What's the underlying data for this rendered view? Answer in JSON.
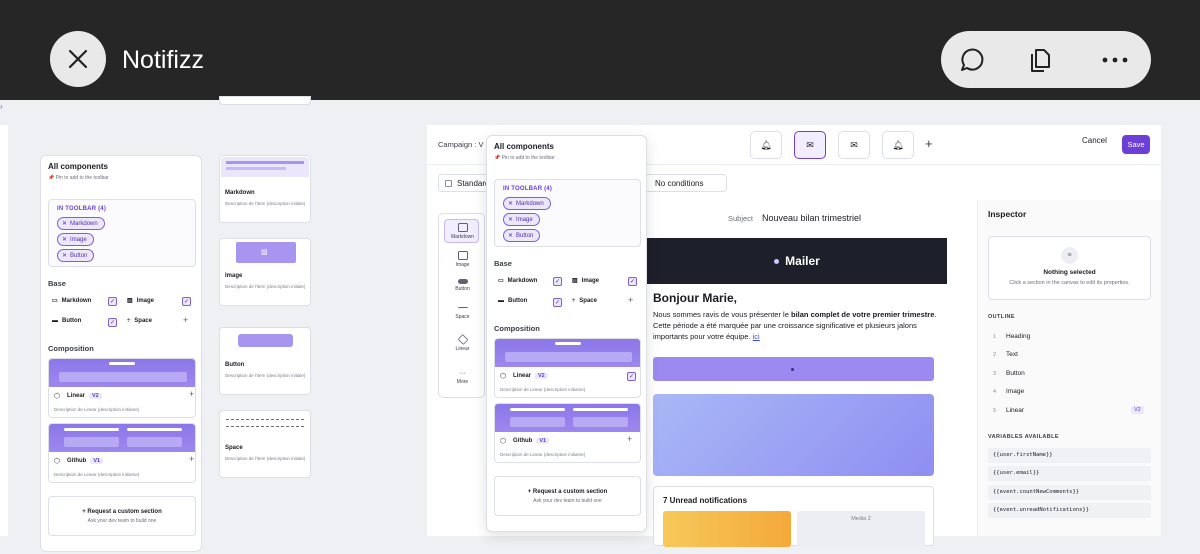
{
  "window": {
    "title": "Notifizz"
  },
  "left_panel": {
    "title": "All components",
    "subtitle": "📌 Pin to add to the toolbar",
    "toolbar_label": "IN TOOLBAR (4)",
    "chips": [
      "Markdown",
      "Image",
      "Button"
    ],
    "base_label": "Base",
    "base_items": [
      "Markdown",
      "Image",
      "Button",
      "Space"
    ],
    "composition_label": "Composition",
    "components": [
      {
        "name": "Linear",
        "badge": "V2",
        "desc": "Description de Linear (description initiame)"
      },
      {
        "name": "Github",
        "badge": "V1",
        "desc": "Description de Linear (description initiame)"
      }
    ],
    "request_title": "+ Request a custom section",
    "request_sub": "Ask your dev team to build one"
  },
  "mini_cards": [
    {
      "title": "Markdown",
      "desc": "Description de l'item (description initiale)"
    },
    {
      "title": "Image",
      "desc": "Description de l'item (description initiale)"
    },
    {
      "title": "Button",
      "desc": "Description de l'item (description initiale)"
    },
    {
      "title": "Space",
      "desc": "Description de l'item (description initiale)"
    }
  ],
  "editor": {
    "campaign_label": "Campaign :",
    "campaign_value": "V",
    "template_select": "Standard",
    "conditions": "No conditions",
    "cancel": "Cancel",
    "save": "Save",
    "rail": [
      "Markdown",
      "Image",
      "Button",
      "Space",
      "Linear",
      "More"
    ],
    "subject_label": "Subject",
    "subject_value": "Nouveau bilan trimestriel",
    "brand": "Mailer",
    "greeting": "Bonjour Marie,",
    "body_1": "Nous sommes ravis de vous présenter le ",
    "body_bold": "bilan complet de votre premier trimestre",
    "body_2": ". Cette période a été marquée par une croissance significative et plusieurs jalons importants pour votre équipe. ",
    "body_link": "ici",
    "notifications_title": "7 Unread notifications",
    "media_label": "Media 2"
  },
  "inspector": {
    "title": "Inspector",
    "empty_title": "Nothing selected",
    "empty_sub": "Click a section in the canvas to edit its properties.",
    "outline_label": "OUTLINE",
    "outline": [
      {
        "n": "1",
        "label": "Heading"
      },
      {
        "n": "2",
        "label": "Text"
      },
      {
        "n": "3",
        "label": "Button"
      },
      {
        "n": "4",
        "label": "Image"
      },
      {
        "n": "5",
        "label": "Linear",
        "badge": "V2"
      }
    ],
    "variables_label": "VARIABLES AVAILABLE",
    "variables": [
      "{{user.firstName}}",
      "{{user.email}}",
      "{{event.countNewComments}}",
      "{{event.unreadNotifications}}"
    ]
  },
  "colors": {
    "accent": "#6d3fd9",
    "topbar": "#262626",
    "email_header": "#1d1f2b"
  }
}
